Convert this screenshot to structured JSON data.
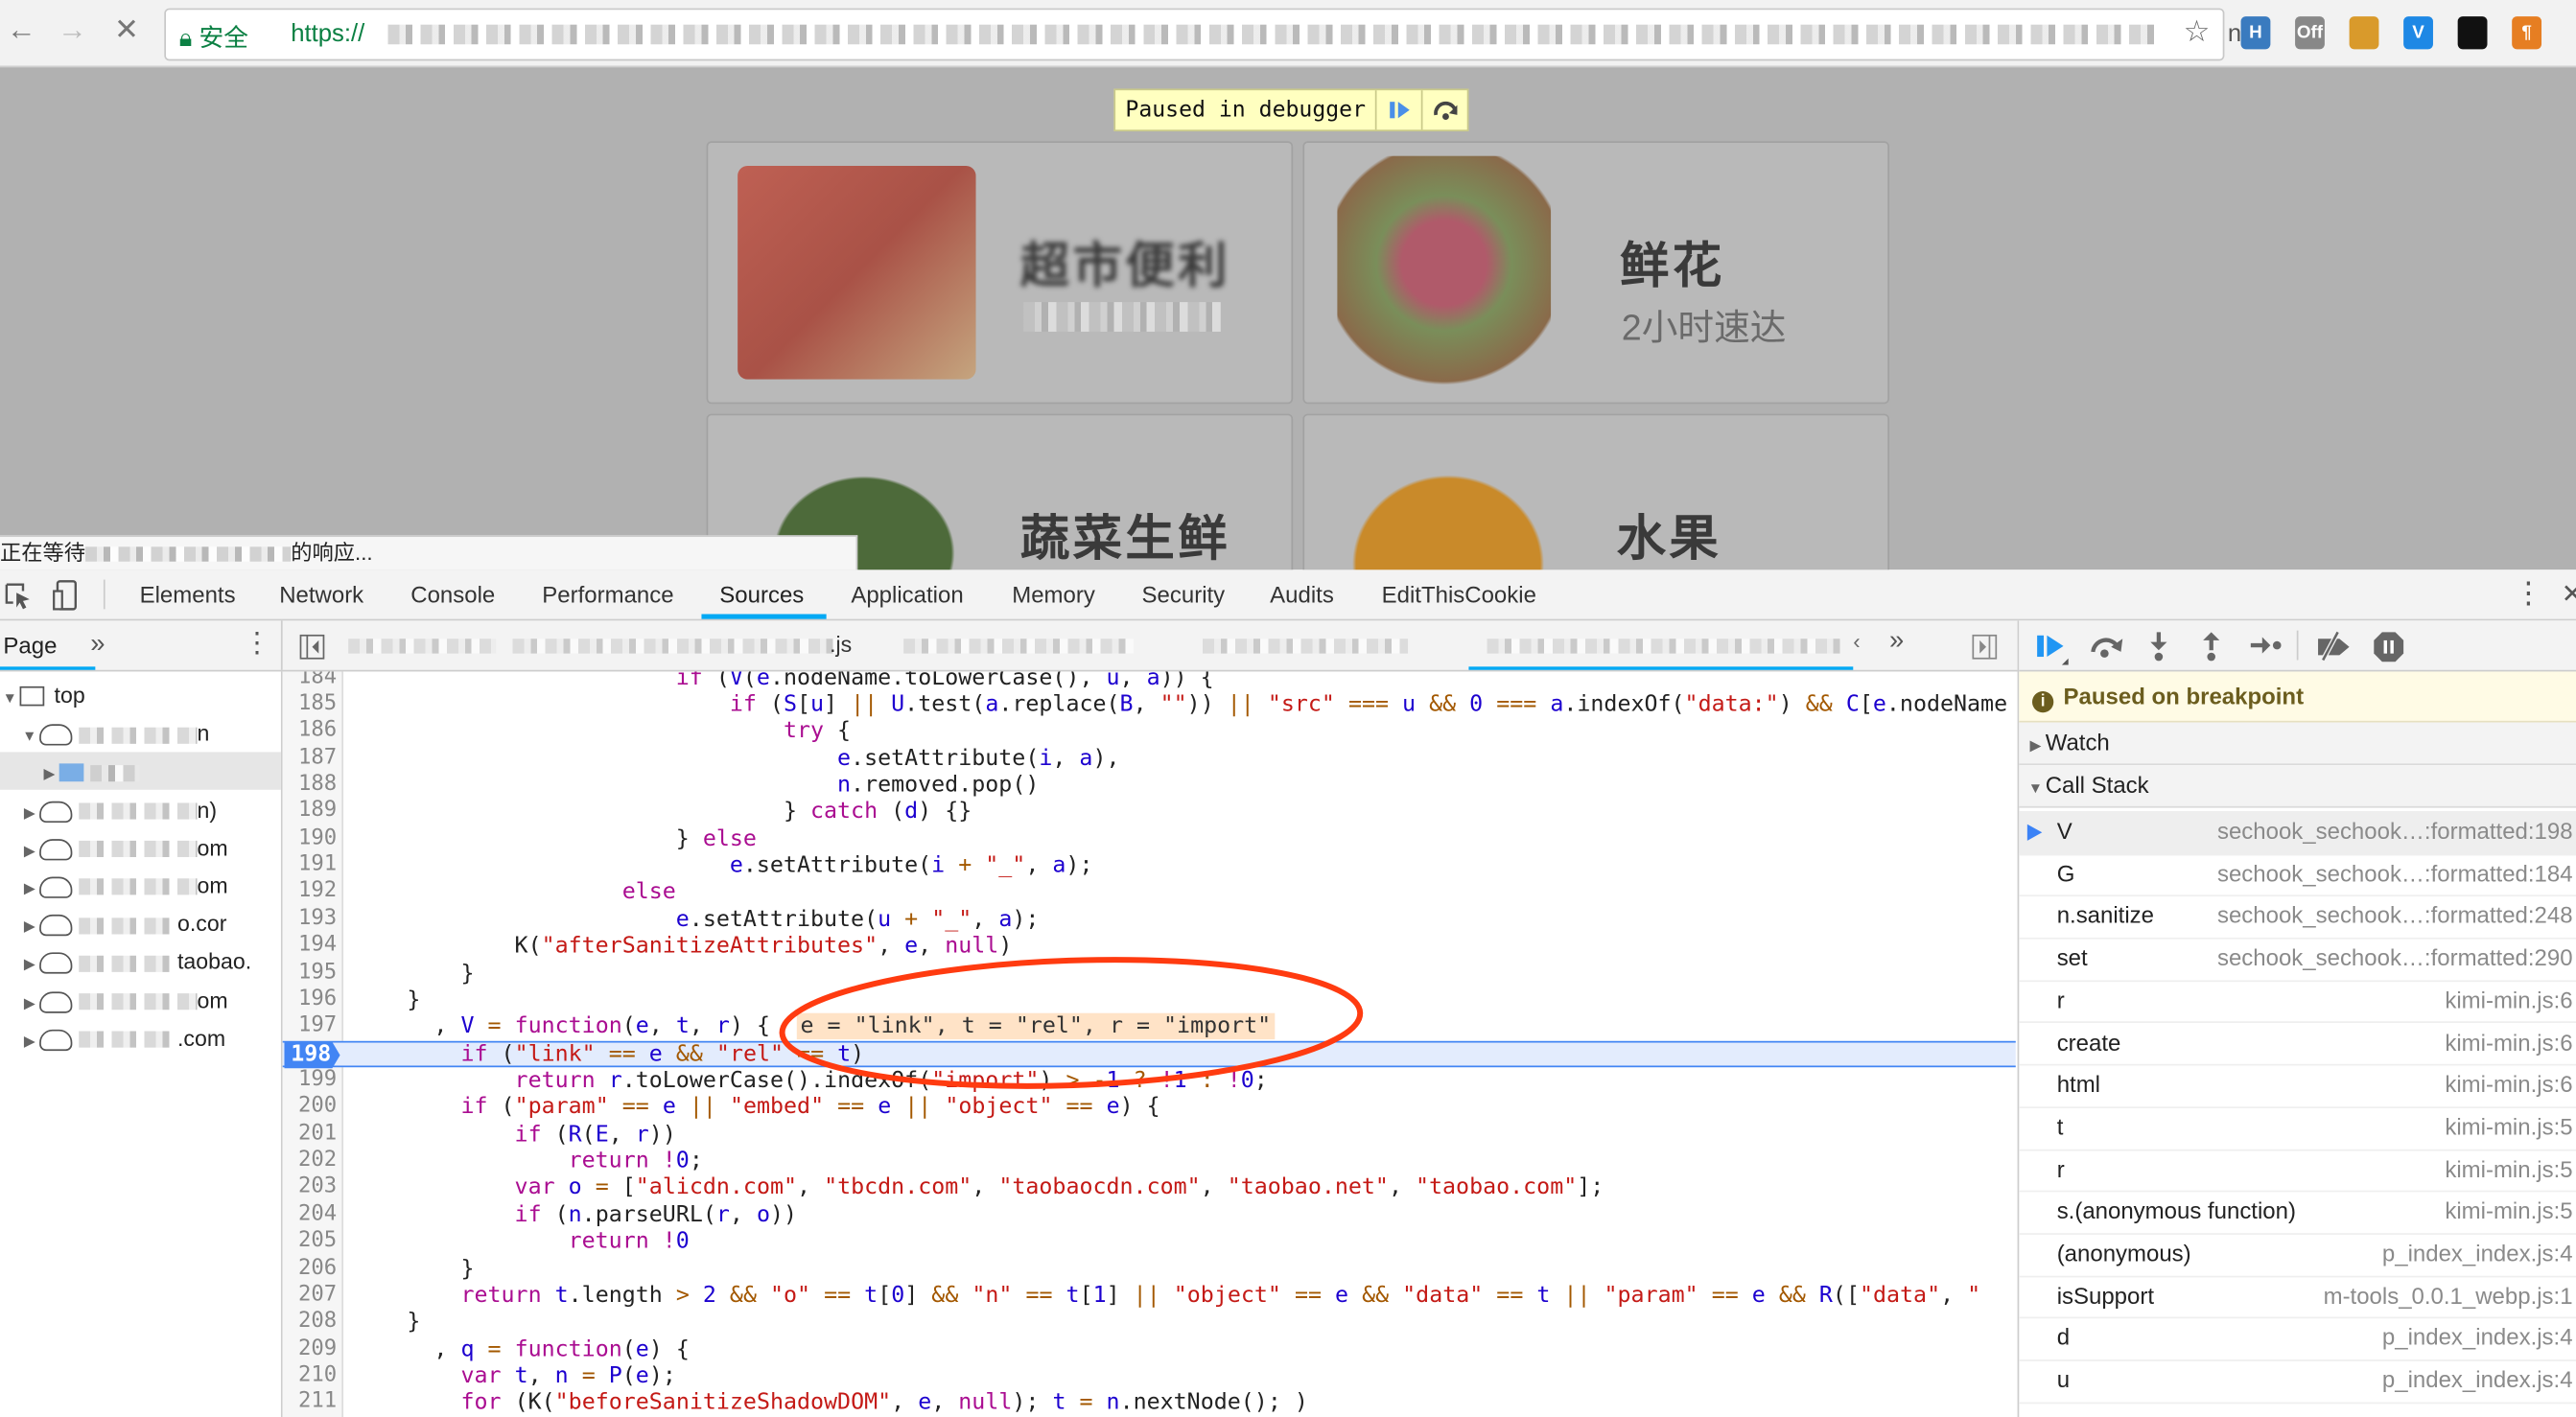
{
  "browser": {
    "secure_label": "安全",
    "url_prefix": "https://",
    "url_suffix": "n...",
    "extensions": [
      {
        "name": "h-extension-icon",
        "color": "#3a7bbf",
        "label": "H"
      },
      {
        "name": "off-extension-icon",
        "color": "#888888",
        "label": "Off"
      },
      {
        "name": "cookie-extension-icon",
        "color": "#d99a2b",
        "label": ""
      },
      {
        "name": "v-extension-icon",
        "color": "#1e88e5",
        "label": "V"
      },
      {
        "name": "mask-extension-icon",
        "color": "#111111",
        "label": ""
      },
      {
        "name": "pilcrow-extension-icon",
        "color": "#e67e22",
        "label": "¶"
      }
    ]
  },
  "page": {
    "paused_banner": "Paused in debugger",
    "cards": [
      {
        "title": "超市便利",
        "subtitle": "",
        "blurred": true
      },
      {
        "title": "鲜花",
        "subtitle": "2小时速达"
      },
      {
        "title": "蔬菜生鲜",
        "subtitle": ""
      },
      {
        "title": "水果",
        "subtitle": ""
      }
    ],
    "status_prefix": "正在等待",
    "status_suffix": "的响应..."
  },
  "devtools": {
    "tabs": [
      "Elements",
      "Network",
      "Console",
      "Performance",
      "Sources",
      "Application",
      "Memory",
      "Security",
      "Audits",
      "EditThisCookie"
    ],
    "active_tab": "Sources",
    "navigator": {
      "tab": "Page",
      "more": "»",
      "items": [
        {
          "label": "top",
          "type": "frame",
          "expanded": true,
          "indent": 0
        },
        {
          "label": "n",
          "type": "domain",
          "expanded": true,
          "indent": 1
        },
        {
          "label": "",
          "type": "folder",
          "expanded": false,
          "indent": 2,
          "selected": true
        },
        {
          "label": "n)",
          "type": "domain",
          "indent": 1
        },
        {
          "label": "om",
          "type": "domain",
          "indent": 1
        },
        {
          "label": "om",
          "type": "domain",
          "indent": 1
        },
        {
          "label": "o.cor",
          "type": "domain",
          "indent": 1
        },
        {
          "label": "taobao.",
          "type": "domain",
          "indent": 1
        },
        {
          "label": "om",
          "type": "domain",
          "indent": 1
        },
        {
          "label": ".com",
          "type": "domain",
          "indent": 1
        }
      ]
    },
    "editor_tabs": [
      {
        "label": ".js"
      },
      {
        "label": ""
      },
      {
        "label": ""
      },
      {
        "label": "",
        "active": true,
        "closable": true
      }
    ],
    "code": {
      "first_line": 184,
      "current_line": 198,
      "lines": [
        "                        if (V(e.nodeName.toLowerCase(), u, a)) {",
        "                            if (S[u] || U.test(a.replace(B, \"\")) || \"src\" === u && 0 === a.indexOf(\"data:\") && C[e.nodeName",
        "                                try {",
        "                                    e.setAttribute(i, a),",
        "                                    n.removed.pop()",
        "                                } catch (d) {}",
        "                        } else",
        "                            e.setAttribute(i + \"_\", a);",
        "                    else",
        "                        e.setAttribute(u + \"_\", a);",
        "            K(\"afterSanitizeAttributes\", e, null)",
        "        }",
        "    }",
        "      , V = function(e, t, r) {",
        "        if (\"link\" == e && \"rel\" == t)",
        "            return r.toLowerCase().indexOf(\"import\") > -1 ? !1 : !0;",
        "        if (\"param\" == e || \"embed\" == e || \"object\" == e) {",
        "            if (R(E, r))",
        "                return !0;",
        "            var o = [\"alicdn.com\", \"tbcdn.com\", \"taobaocdn.com\", \"taobao.net\", \"taobao.com\"];",
        "            if (n.parseURL(r, o))",
        "                return !0",
        "        }",
        "        return t.length > 2 && \"o\" == t[0] && \"n\" == t[1] || \"object\" == e && \"data\" == t || \"param\" == e && R([\"data\", \"",
        "    }",
        "      , q = function(e) {",
        "        var t, n = P(e);",
        "        for (K(\"beforeSanitizeShadowDOM\", e, null); t = n.nextNode(); )"
      ],
      "inline_values": {
        "197": "e = \"link\", t = \"rel\", r = \"import\""
      }
    },
    "debugger": {
      "paused_message": "Paused on breakpoint",
      "watch_label": "Watch",
      "call_stack_label": "Call Stack",
      "call_stack": [
        {
          "fn": "V",
          "loc": "sechook_sechook…:formatted:198",
          "current": true
        },
        {
          "fn": "G",
          "loc": "sechook_sechook…:formatted:184"
        },
        {
          "fn": "n.sanitize",
          "loc": "sechook_sechook…:formatted:248"
        },
        {
          "fn": "set",
          "loc": "sechook_sechook…:formatted:290"
        },
        {
          "fn": "r",
          "loc": "kimi-min.js:6"
        },
        {
          "fn": "create",
          "loc": "kimi-min.js:6"
        },
        {
          "fn": "html",
          "loc": "kimi-min.js:6"
        },
        {
          "fn": "t",
          "loc": "kimi-min.js:5"
        },
        {
          "fn": "r",
          "loc": "kimi-min.js:5"
        },
        {
          "fn": "s.(anonymous function)",
          "loc": "kimi-min.js:5"
        },
        {
          "fn": "(anonymous)",
          "loc": "p_index_index.js:4"
        },
        {
          "fn": "isSupport",
          "loc": "m-tools_0.0.1_webp.js:1"
        },
        {
          "fn": "d",
          "loc": "p_index_index.js:4"
        },
        {
          "fn": "u",
          "loc": "p_index_index.js:4"
        }
      ]
    },
    "colors": {
      "accent": "#03a9f4",
      "breakpoint": "#4285f4",
      "annotation": "#ff3b10"
    }
  }
}
